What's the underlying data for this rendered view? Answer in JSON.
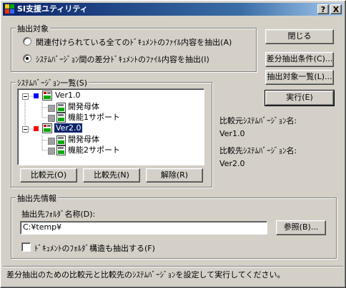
{
  "window": {
    "title": "SI支援ユティリティ"
  },
  "titlebar_buttons": {
    "help": "?",
    "close": "X"
  },
  "extract_target": {
    "group_label": "抽出対象",
    "options": [
      {
        "label": "関連付けられている全てのﾄﾞｷｭﾒﾝﾄのﾌｧｲﾙ内容を抽出(A)",
        "selected": false
      },
      {
        "label": "ｼｽﾃﾑﾊﾞｰｼﾞｮﾝ間の差分ﾄﾞｷｭﾒﾝﾄのﾌｧｲﾙ内容を抽出(I)",
        "selected": true
      }
    ]
  },
  "system_versions": {
    "group_label": "ｼｽﾃﾑﾊﾞｰｼﾞｮﾝ一覧(S)",
    "tree": [
      {
        "label": "Ver1.0",
        "flag_color": "#0000ff",
        "children": [
          "開発母体",
          "機能1サポート"
        ]
      },
      {
        "label": "Ver2.0",
        "flag_color": "#ff0000",
        "selected": true,
        "children": [
          "開発母体",
          "機能2サポート"
        ]
      }
    ],
    "buttons": {
      "source": "比較元(O)",
      "target": "比較先(N)",
      "clear": "解除(R)"
    }
  },
  "side_buttons": {
    "close": "閉じる",
    "diff_conditions": "差分抽出条件(C)...",
    "extract_list": "抽出対象一覧(L)...",
    "execute": "実行(E)"
  },
  "comparison": {
    "source_label": "比較元ｼｽﾃﾑﾊﾞｰｼﾞｮﾝ名:",
    "source_value": "Ver1.0",
    "target_label": "比較先ｼｽﾃﾑﾊﾞｰｼﾞｮﾝ名:",
    "target_value": "Ver2.0"
  },
  "destination": {
    "group_label": "抽出先情報",
    "folder_label": "抽出先ﾌｫﾙﾀﾞ名称(D):",
    "folder_value": "C:¥temp¥",
    "browse_button": "参照(B)...",
    "structure_checkbox": {
      "label": "ﾄﾞｷｭﾒﾝﾄのﾌｫﾙﾀﾞ構造も抽出する(F)",
      "checked": false
    }
  },
  "status_text": "差分抽出のための比較元と比較先のｼｽﾃﾑﾊﾞｰｼﾞｮﾝを設定して実行してください。",
  "colors": {
    "titlebar": "#0a246a",
    "selection": "#0a246a",
    "face": "#d4d0c8"
  }
}
